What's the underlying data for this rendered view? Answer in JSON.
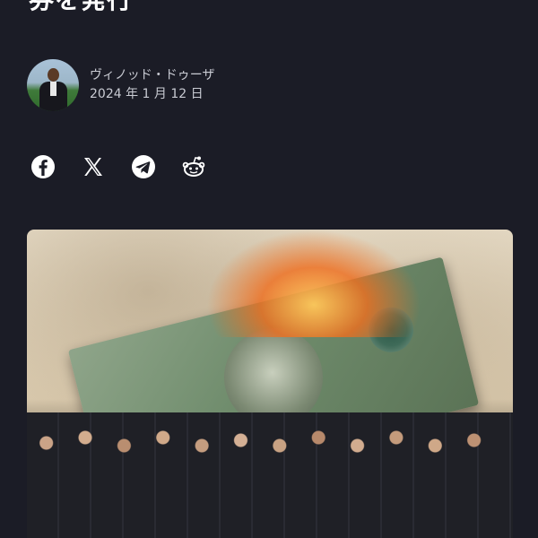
{
  "article": {
    "title_partial": "券を発行",
    "author": "ヴィノッド・ドゥーザ",
    "date": "2024 年 1 月 12 日"
  },
  "share": {
    "buttons": [
      {
        "name": "facebook",
        "icon": "facebook-icon"
      },
      {
        "name": "x",
        "icon": "x-icon"
      },
      {
        "name": "telegram",
        "icon": "telegram-icon"
      },
      {
        "name": "reddit",
        "icon": "reddit-icon"
      }
    ]
  },
  "colors": {
    "background": "#1b1c26",
    "text": "#ffffff",
    "meta_text": "#c9cbd3"
  }
}
